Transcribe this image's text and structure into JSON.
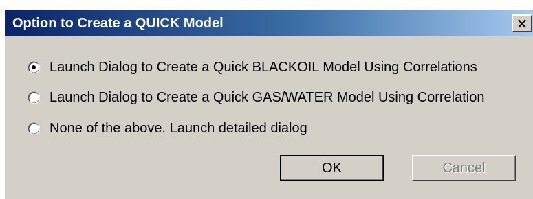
{
  "window": {
    "title": "Option to Create a QUICK Model",
    "close_icon": "close-icon"
  },
  "options": [
    {
      "label": "Launch Dialog to Create a Quick BLACKOIL Model Using Correlations",
      "selected": true
    },
    {
      "label": "Launch Dialog to Create a Quick GAS/WATER Model Using Correlation",
      "selected": false
    },
    {
      "label": "None of the above. Launch detailed dialog",
      "selected": false
    }
  ],
  "buttons": {
    "ok_label": "OK",
    "cancel_label": "Cancel",
    "cancel_enabled": false
  },
  "colors": {
    "title_gradient_start": "#0a246a",
    "title_gradient_end": "#a6caf0",
    "dialog_background": "#d4d0c8",
    "disabled_text": "#808080"
  }
}
